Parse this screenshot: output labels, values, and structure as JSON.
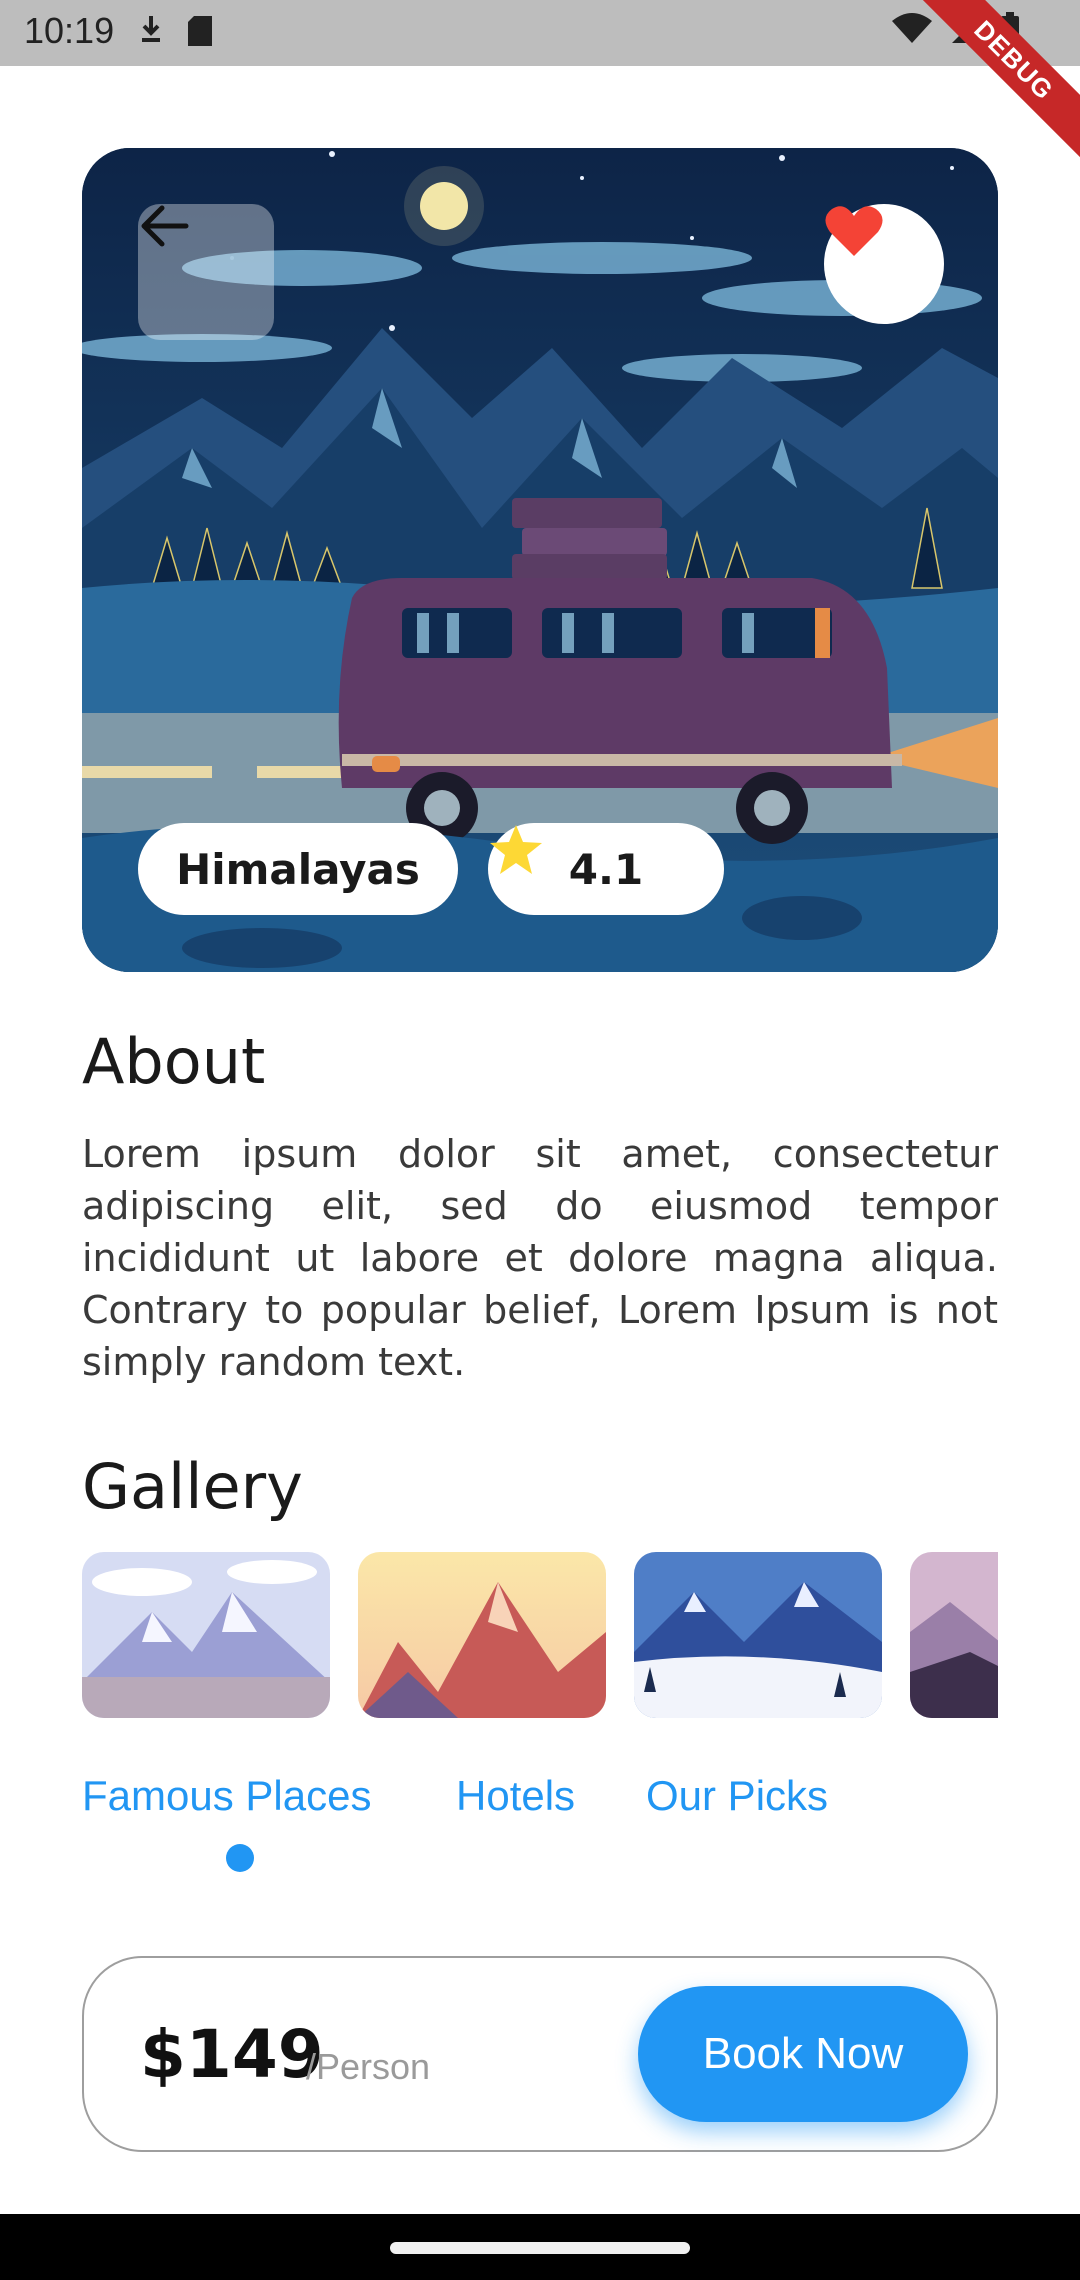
{
  "status_bar": {
    "time": "10:19",
    "debug_banner": "DEBUG"
  },
  "hero": {
    "place_name": "Himalayas",
    "rating": "4.1",
    "icons": [
      "back-arrow-icon",
      "heart-icon",
      "star-icon"
    ],
    "colors": {
      "heart": "#f44336",
      "star": "#fdd835"
    }
  },
  "about": {
    "title": "About",
    "text": "Lorem ipsum dolor sit amet, consectetur adipiscing elit, sed do eiusmod tempor incididunt ut labore et dolore magna aliqua. Contrary to popular belief, Lorem Ipsum is not simply random text."
  },
  "gallery": {
    "title": "Gallery",
    "items": [
      "snowy-mountains",
      "sunset-peaks",
      "winter-valley",
      "purple-hills"
    ]
  },
  "tabs": {
    "items": [
      "Famous Places",
      "Hotels",
      "Our Picks"
    ],
    "active": "Famous Places"
  },
  "booking": {
    "price": "$149",
    "per": "/Person",
    "button": "Book Now"
  },
  "theme": {
    "accent": "#2196f3"
  }
}
